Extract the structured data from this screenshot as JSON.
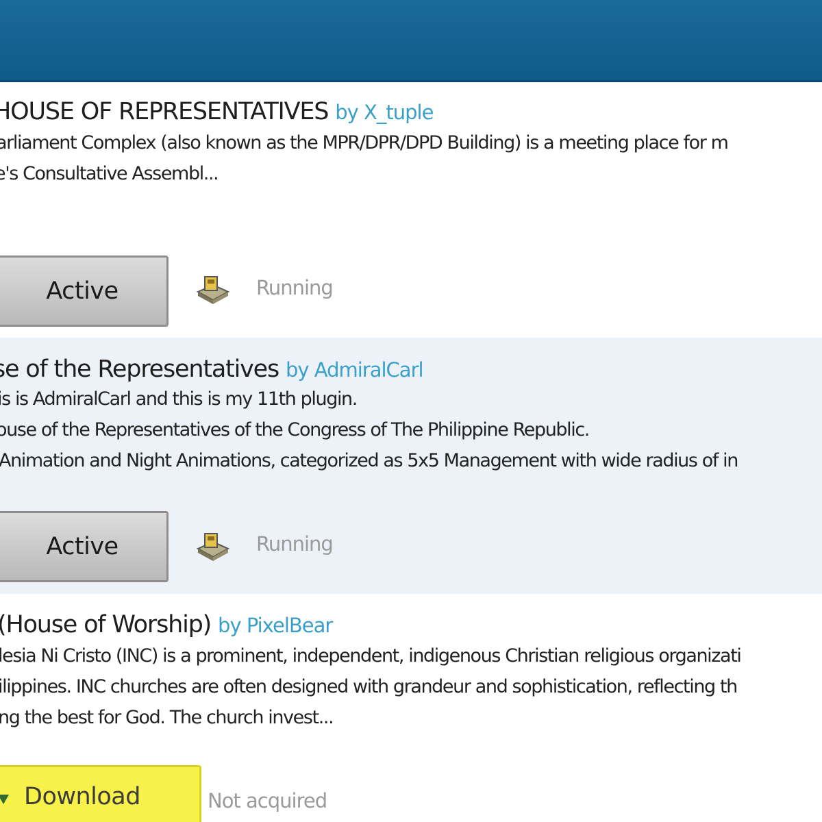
{
  "items": [
    {
      "title": "HOUSE OF REPRESENTATIVES",
      "author": "by X_tuple",
      "description": [
        "arliament Complex (also known as the MPR/DPR/DPD Building) is a meeting place for m",
        "e's Consultative Assembl..."
      ],
      "button_label": "Active",
      "status": "Running"
    },
    {
      "title": "se of the Representatives",
      "author": "by AdmiralCarl",
      "description": [
        "is is AdmiralCarl and this is my 11th plugin.",
        "ouse of the Representatives of the Congress of The Philippine Republic.",
        "Animation and Night Animations, categorized as 5x5 Management with wide radius of in"
      ],
      "button_label": "Active",
      "status": "Running"
    },
    {
      "title": "(House of Worship)",
      "author": "by PixelBear",
      "description": [
        "lesia Ni Cristo (INC) is a prominent, independent, indigenous Christian religious organizati",
        "ilippines. INC churches are often designed with grandeur and sophistication, reflecting th",
        "ng the best for God. The church invest..."
      ],
      "button_label": "Download",
      "status": "Not acquired"
    }
  ],
  "colors": {
    "header": "#0f5a89",
    "author_link": "#3aa0c9",
    "alt_row": "#edf2f9",
    "download_button": "#f7f14a"
  },
  "icons": {
    "status": "building-plot-icon",
    "download": "download-arrow-icon"
  }
}
